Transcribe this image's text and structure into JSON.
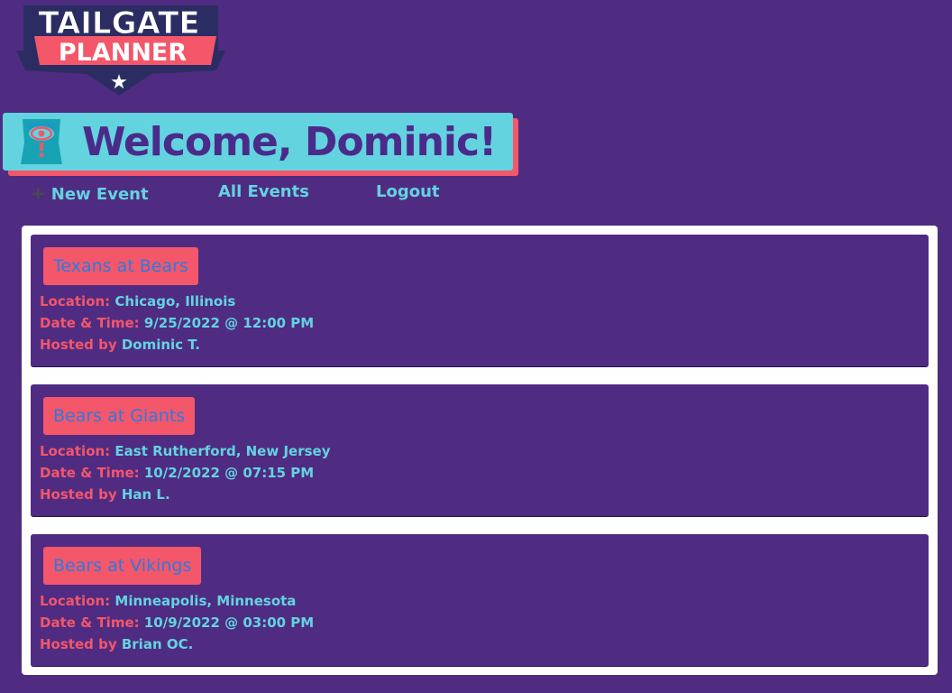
{
  "logo": {
    "line1": "TAILGATE",
    "line2": "PLANNER",
    "star": "★"
  },
  "header": {
    "welcome_text": "Welcome, Dominic!",
    "icon": "referee-jersey-icon"
  },
  "nav": {
    "new_event_icon": "+",
    "new_event_label": "New Event",
    "all_events_label": "All Events",
    "logout_label": "Logout"
  },
  "labels": {
    "location": "Location:",
    "datetime": "Date & Time:",
    "hosted_by": "Hosted by"
  },
  "events": [
    {
      "title": "Texans at Bears",
      "location": "Chicago, Illinois",
      "datetime": "9/25/2022 @ 12:00 PM",
      "host": "Dominic T."
    },
    {
      "title": "Bears at Giants",
      "location": "East Rutherford, New Jersey",
      "datetime": "10/2/2022 @ 07:15 PM",
      "host": "Han L."
    },
    {
      "title": "Bears at Vikings",
      "location": "Minneapolis, Minnesota",
      "datetime": "10/9/2022 @ 03:00 PM",
      "host": "Brian OC."
    }
  ],
  "colors": {
    "background": "#4f2c82",
    "accent_cyan": "#63d3e0",
    "accent_coral": "#f4566a",
    "title_blue": "#2a7be0",
    "navy": "#2b2d62"
  }
}
